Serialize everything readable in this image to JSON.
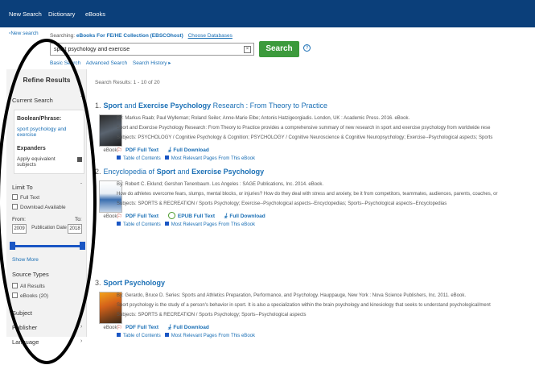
{
  "topnav": {
    "new_search": "New Search",
    "dictionary": "Dictionary",
    "ebooks": "eBooks"
  },
  "search": {
    "logo_alt": "New search",
    "searching_label": "Searching:",
    "database": "eBooks For FE/HE Collection (EBSCOhost)",
    "choose_databases": "Choose Databases",
    "query": "sport psychology and exercise",
    "clear": "×",
    "button": "Search",
    "help": "?",
    "basic_search": "Basic Search",
    "advanced_search": "Advanced Search",
    "search_history": "Search History ▸"
  },
  "sidebar": {
    "refine_title": "Refine Results",
    "current_search": "Current Search",
    "boolean_label": "Boolean/Phrase:",
    "boolean_value": "sport psychology and exercise",
    "expanders": "Expanders",
    "apply_equivalent": "Apply equivalent subjects",
    "limit_to": "Limit To",
    "full_text": "Full Text",
    "download_available": "Download Available",
    "from": "From:",
    "to": "To:",
    "from_year": "2009",
    "to_year": "2018",
    "publication_date": "Publication Date",
    "show_more": "Show More",
    "source_types": "Source Types",
    "all_results": "All Results",
    "ebooks_count": "eBooks (20)",
    "subject": "Subject",
    "publisher": "Publisher",
    "language": "Language",
    "chevron": "›",
    "collapse": "ˇ"
  },
  "results_header": "Search Results: 1 - 10 of 20",
  "results": [
    {
      "num": "1.",
      "title_a": "Sport",
      "title_b": " and ",
      "title_c": "Exercise Psychology",
      "title_d": " Research : From Theory to Practice",
      "byline": "By: Markus Raab; Paul Wylleman; Roland Seiler; Anne-Marie Elbe; Antonis Hatzigeorgiadis. London, UK : Academic Press. 2016. eBook.",
      "abstract": "Sport and Exercise Psychology Research: From Theory to Practice provides a comprehensive summary of new research in sport and exercise psychology from worldwide rese",
      "subjects": "Subjects: PSYCHOLOGY / Cognitive Psychology & Cognition; PSYCHOLOGY / Cognitive Neuroscience & Cognitive Neuropsychology; Exercise--Psychological aspects; Sports",
      "pdf": "PDF Full Text",
      "epub": "",
      "download": "Full Download",
      "toc": "Table of Contents",
      "relevant": "Most Relevant Pages From This eBook",
      "type": "eBook"
    },
    {
      "num": "2.",
      "title_a": "Encyclopedia of ",
      "title_b": "Sport",
      "title_c": " and ",
      "title_d": "Exercise Psychology",
      "byline": "By: Robert C. Eklund; Gershon Tenenbaum. Los Angeles : SAGE Publications, Inc. 2014. eBook.",
      "abstract": "How do athletes overcome fears, slumps, mental blocks, or injuries? How do they deal with stress and anxiety, be it from competitors, teammates, audiences, parents, coaches, or",
      "subjects": "Subjects: SPORTS & RECREATION / Sports Psychology; Exercise--Psychological aspects--Encyclopedias; Sports--Psychological aspects--Encyclopedias",
      "pdf": "PDF Full Text",
      "epub": "EPUB Full Text",
      "download": "Full Download",
      "toc": "Table of Contents",
      "relevant": "Most Relevant Pages From This eBook",
      "type": "eBook"
    },
    {
      "num": "3.",
      "title_a": "Sport Psychology",
      "title_b": "",
      "title_c": "",
      "title_d": "",
      "byline": "By: Gerardo, Bruce D. Series: Sports and Athletics Preparation, Performance, and Psychology. Hauppauge, New York : Nova Science Publishers, Inc. 2011. eBook.",
      "abstract": "Sport psychology is the study of a person's behavior in sport. It is also a specialization within the brain psychology and kinesiology that seeks to understand psychological/ment",
      "subjects": "Subjects: SPORTS & RECREATION / Sports Psychology; Sports--Psychological aspects",
      "pdf": "PDF Full Text",
      "epub": "",
      "download": "Full Download",
      "toc": "Table of Contents",
      "relevant": "Most Relevant Pages From This eBook",
      "type": "eBook"
    }
  ],
  "colors": {
    "topbar": "#0b3f7a",
    "accent": "#1a6fb5",
    "search_button": "#3c9a3c",
    "annotation": "#000000"
  }
}
